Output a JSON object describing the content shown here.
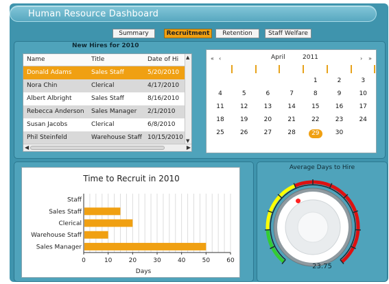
{
  "window": {
    "title": "Human Resource Dashboard"
  },
  "tabs": [
    {
      "label": "Summary",
      "active": false
    },
    {
      "label": "Recruitment",
      "active": true
    },
    {
      "label": "Retention",
      "active": false
    },
    {
      "label": "Staff Welfare",
      "active": false
    }
  ],
  "new_hires": {
    "heading": "New Hires for 2010",
    "columns": [
      "Name",
      "Title",
      "Date of Hi"
    ],
    "rows": [
      {
        "name": "Donald Adams",
        "title": "Sales Staff",
        "date": "5/20/2010",
        "selected": true
      },
      {
        "name": "Nora Chin",
        "title": "Clerical",
        "date": "4/17/2010",
        "selected": false
      },
      {
        "name": "Albert Albright",
        "title": "Sales Staff",
        "date": "8/16/2010",
        "selected": false
      },
      {
        "name": "Rebecca Anderson",
        "title": "Sales Manager",
        "date": "2/1/2010",
        "selected": false
      },
      {
        "name": "Susan Jacobs",
        "title": "Clerical",
        "date": "6/8/2010",
        "selected": false
      },
      {
        "name": "Phil Steinfeld",
        "title": "Warehouse Staff",
        "date": "10/15/2010",
        "selected": false
      }
    ]
  },
  "calendar": {
    "month": "April",
    "year": "2011",
    "nav": {
      "prev_year": "«",
      "prev_month": "‹",
      "next_month": "›",
      "next_year": "»"
    },
    "weeks": [
      [
        "",
        "",
        "",
        "",
        "1",
        "2",
        "3"
      ],
      [
        "4",
        "5",
        "6",
        "7",
        "8",
        "9",
        "10"
      ],
      [
        "11",
        "12",
        "13",
        "14",
        "15",
        "16",
        "17"
      ],
      [
        "18",
        "19",
        "20",
        "21",
        "22",
        "23",
        "24"
      ],
      [
        "25",
        "26",
        "27",
        "28",
        "29",
        "30",
        ""
      ]
    ],
    "highlighted_day": "29",
    "accent_color": "#f0a012"
  },
  "chart_data": {
    "type": "bar",
    "orientation": "horizontal",
    "title": "Time to Recruit in 2010",
    "categories": [
      "Staff",
      "Sales Staff",
      "Clerical",
      "Warehouse Staff",
      "Sales Manager"
    ],
    "values": [
      0,
      15,
      20,
      10,
      50
    ],
    "xlabel": "Days",
    "ylabel": "",
    "xlim": [
      0,
      60
    ],
    "xticks": [
      "0",
      "10",
      "20",
      "30",
      "40",
      "50",
      "60"
    ],
    "grid": "vertical",
    "bar_color": "#f0a012"
  },
  "gauge": {
    "title": "Average Days to Hire",
    "value": "23.75",
    "value_number": 23.75,
    "range": [
      0,
      60
    ],
    "bands": [
      {
        "color": "#33cc33",
        "from": 0,
        "to": 10
      },
      {
        "color": "#ffff00",
        "from": 10,
        "to": 25
      },
      {
        "color": "#dd1111",
        "from": 25,
        "to": 60
      }
    ]
  }
}
